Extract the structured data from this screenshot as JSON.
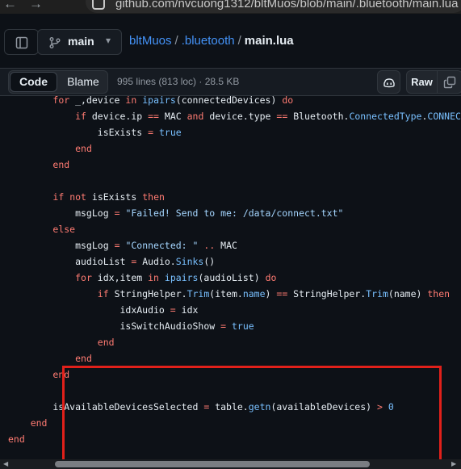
{
  "browser": {
    "back": "←",
    "forward": "→",
    "url": "github.com/nvcuong1312/bltMuos/blob/main/.bluetooth/main.lua"
  },
  "header": {
    "branch": "main",
    "caret": "▾",
    "breadcrumb": [
      {
        "text": "bltMuos"
      },
      {
        "text": ".bluetooth"
      }
    ],
    "separator": "/",
    "current_file": "main.lua"
  },
  "toolbar": {
    "code_tab": "Code",
    "blame_tab": "Blame",
    "file_meta": "995 lines (813 loc) · 28.5 KB",
    "raw_label": "Raw"
  },
  "code": {
    "lines": [
      [
        {
          "t": "        "
        },
        {
          "t": "for",
          "c": "kw"
        },
        {
          "t": " _,device "
        },
        {
          "t": "in",
          "c": "kw"
        },
        {
          "t": " "
        },
        {
          "t": "ipairs",
          "c": "cn"
        },
        {
          "t": "(connectedDevices) "
        },
        {
          "t": "do",
          "c": "kw"
        }
      ],
      [
        {
          "t": "            "
        },
        {
          "t": "if",
          "c": "kw"
        },
        {
          "t": " device.ip "
        },
        {
          "t": "==",
          "c": "kw"
        },
        {
          "t": " MAC "
        },
        {
          "t": "and",
          "c": "kw"
        },
        {
          "t": " device.type "
        },
        {
          "t": "==",
          "c": "kw"
        },
        {
          "t": " Bluetooth."
        },
        {
          "t": "ConnectedType",
          "c": "cn"
        },
        {
          "t": "."
        },
        {
          "t": "CONNECTED",
          "c": "cn"
        }
      ],
      [
        {
          "t": "                isExists "
        },
        {
          "t": "=",
          "c": "kw"
        },
        {
          "t": " "
        },
        {
          "t": "true",
          "c": "cn"
        }
      ],
      [
        {
          "t": "            "
        },
        {
          "t": "end",
          "c": "kw"
        }
      ],
      [
        {
          "t": "        "
        },
        {
          "t": "end",
          "c": "kw"
        }
      ],
      [
        {
          "t": ""
        }
      ],
      [
        {
          "t": "        "
        },
        {
          "t": "if",
          "c": "kw"
        },
        {
          "t": " "
        },
        {
          "t": "not",
          "c": "kw"
        },
        {
          "t": " isExists "
        },
        {
          "t": "then",
          "c": "kw"
        }
      ],
      [
        {
          "t": "            msgLog "
        },
        {
          "t": "=",
          "c": "kw"
        },
        {
          "t": " "
        },
        {
          "t": "\"Failed! Send to me: /data/connect.txt\"",
          "c": "st"
        }
      ],
      [
        {
          "t": "        "
        },
        {
          "t": "else",
          "c": "kw"
        }
      ],
      [
        {
          "t": "            msgLog "
        },
        {
          "t": "=",
          "c": "kw"
        },
        {
          "t": " "
        },
        {
          "t": "\"Connected: \"",
          "c": "st"
        },
        {
          "t": " "
        },
        {
          "t": "..",
          "c": "kw"
        },
        {
          "t": " MAC"
        }
      ],
      [
        {
          "t": "            audioList "
        },
        {
          "t": "=",
          "c": "kw"
        },
        {
          "t": " Audio."
        },
        {
          "t": "Sinks",
          "c": "cn"
        },
        {
          "t": "()"
        }
      ],
      [
        {
          "t": "            "
        },
        {
          "t": "for",
          "c": "kw"
        },
        {
          "t": " idx,item "
        },
        {
          "t": "in",
          "c": "kw"
        },
        {
          "t": " "
        },
        {
          "t": "ipairs",
          "c": "cn"
        },
        {
          "t": "(audioList) "
        },
        {
          "t": "do",
          "c": "kw"
        }
      ],
      [
        {
          "t": "                "
        },
        {
          "t": "if",
          "c": "kw"
        },
        {
          "t": " StringHelper."
        },
        {
          "t": "Trim",
          "c": "cn"
        },
        {
          "t": "(item."
        },
        {
          "t": "name",
          "c": "cn"
        },
        {
          "t": ") "
        },
        {
          "t": "==",
          "c": "kw"
        },
        {
          "t": " StringHelper."
        },
        {
          "t": "Trim",
          "c": "cn"
        },
        {
          "t": "(name) "
        },
        {
          "t": "then",
          "c": "kw"
        }
      ],
      [
        {
          "t": "                    idxAudio "
        },
        {
          "t": "=",
          "c": "kw"
        },
        {
          "t": " idx"
        }
      ],
      [
        {
          "t": "                    isSwitchAudioShow "
        },
        {
          "t": "=",
          "c": "kw"
        },
        {
          "t": " "
        },
        {
          "t": "true",
          "c": "cn"
        }
      ],
      [
        {
          "t": "                "
        },
        {
          "t": "end",
          "c": "kw"
        }
      ],
      [
        {
          "t": "            "
        },
        {
          "t": "end",
          "c": "kw"
        }
      ],
      [
        {
          "t": "        "
        },
        {
          "t": "end",
          "c": "kw"
        }
      ],
      [
        {
          "t": ""
        }
      ],
      [
        {
          "t": "        isAvailableDevicesSelected "
        },
        {
          "t": "=",
          "c": "kw"
        },
        {
          "t": " table."
        },
        {
          "t": "getn",
          "c": "cn"
        },
        {
          "t": "(availableDevices) "
        },
        {
          "t": ">",
          "c": "kw"
        },
        {
          "t": " "
        },
        {
          "t": "0",
          "c": "cn"
        }
      ],
      [
        {
          "t": "    "
        },
        {
          "t": "end",
          "c": "kw"
        }
      ],
      [
        {
          "t": "end",
          "c": "kw"
        }
      ]
    ]
  },
  "colors": {
    "highlight_box": "#e0201a",
    "keyword": "#ff7b72",
    "constant": "#79c0ff",
    "string": "#a5d6ff"
  },
  "icons": [
    "sidebar-toggle-icon",
    "git-branch-icon",
    "copilot-icon",
    "copy-icon"
  ]
}
